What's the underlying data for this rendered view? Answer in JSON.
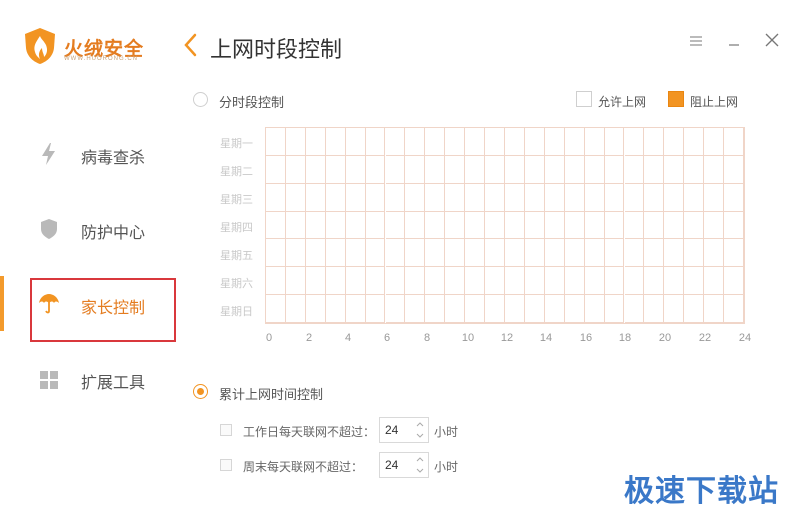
{
  "app": {
    "name": "火绒安全",
    "url": "WWW.HUORONG.CN",
    "accent": "#f29422"
  },
  "sidebar": {
    "items": [
      {
        "label": "病毒查杀",
        "icon": "lightning-icon"
      },
      {
        "label": "防护中心",
        "icon": "shield-icon"
      },
      {
        "label": "家长控制",
        "icon": "umbrella-icon",
        "active": true
      },
      {
        "label": "扩展工具",
        "icon": "grid-icon"
      }
    ]
  },
  "header": {
    "title": "上网时段控制"
  },
  "schedule": {
    "option_label": "分时段控制",
    "selected": false,
    "legend": {
      "allow": "允许上网",
      "block": "阻止上网"
    },
    "days": [
      "星期一",
      "星期二",
      "星期三",
      "星期四",
      "星期五",
      "星期六",
      "星期日"
    ],
    "hour_labels": [
      "0",
      "2",
      "4",
      "6",
      "8",
      "10",
      "12",
      "14",
      "16",
      "18",
      "20",
      "22",
      "24"
    ]
  },
  "cumulative": {
    "option_label": "累计上网时间控制",
    "selected": true,
    "weekday": {
      "label": "工作日每天联网不超过：",
      "value": "24",
      "unit": "小时",
      "checked": false
    },
    "weekend": {
      "label": "周末每天联网不超过：",
      "value": "24",
      "unit": "小时",
      "checked": false
    }
  },
  "watermark": "极速下载站"
}
